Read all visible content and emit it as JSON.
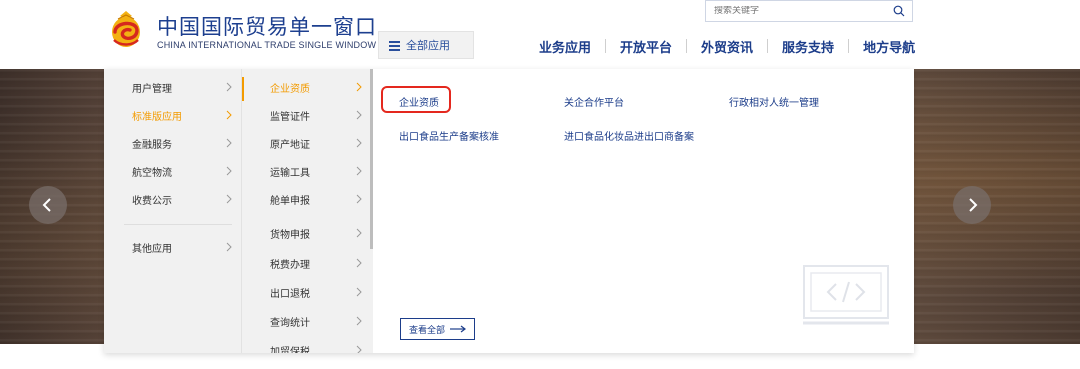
{
  "header": {
    "logo_cn": "中国国际贸易单一窗口",
    "logo_en": "CHINA INTERNATIONAL TRADE SINGLE WINDOW",
    "all_apps_label": "全部应用",
    "search_placeholder": "搜索关键字",
    "nav": [
      "业务应用",
      "开放平台",
      "外贸资讯",
      "服务支持",
      "地方导航"
    ]
  },
  "menu": {
    "level1": [
      {
        "label": "用户管理"
      },
      {
        "label": "标准版应用"
      },
      {
        "label": "金融服务"
      },
      {
        "label": "航空物流"
      },
      {
        "label": "收费公示"
      },
      {
        "label": "其他应用"
      }
    ],
    "level1_active": "标准版应用",
    "level2": [
      {
        "label": "企业资质"
      },
      {
        "label": "监管证件"
      },
      {
        "label": "原产地证"
      },
      {
        "label": "运输工具"
      },
      {
        "label": "舱单申报"
      },
      {
        "label": "货物申报"
      },
      {
        "label": "税费办理"
      },
      {
        "label": "出口退税"
      },
      {
        "label": "查询统计"
      },
      {
        "label": "加贸保税"
      }
    ],
    "level2_active": "企业资质",
    "level3": [
      {
        "label": "企业资质"
      },
      {
        "label": "关企合作平台"
      },
      {
        "label": "行政相对人统一管理"
      },
      {
        "label": "出口食品生产备案核准"
      },
      {
        "label": "进口食品化妆品进出口商备案"
      }
    ],
    "view_all_label": "查看全部"
  },
  "colors": {
    "brand_blue": "#1c3d8a",
    "active_orange": "#f39b00",
    "highlight_red": "#e4281e",
    "menu_bg": "#f1f1f1"
  },
  "icons": [
    "logo-emblem-icon",
    "menu-icon",
    "search-icon",
    "chevron-right-icon",
    "arrow-left-icon",
    "arrow-right-icon",
    "long-arrow-right-icon",
    "code-icon"
  ]
}
